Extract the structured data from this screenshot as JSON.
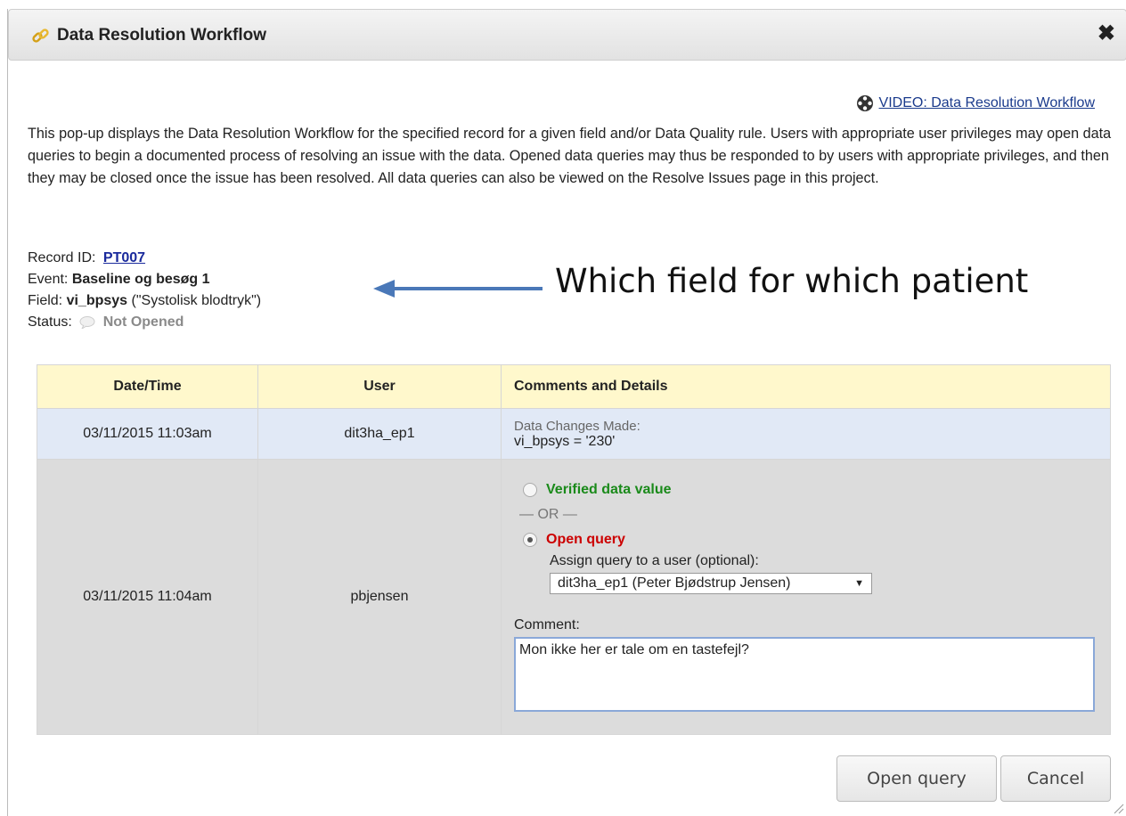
{
  "dialog": {
    "title": "Data Resolution Workflow",
    "close_symbol": "✖",
    "video_link": "VIDEO: Data Resolution Workflow",
    "intro": "This pop-up displays the Data Resolution Workflow for the specified record for a given field and/or Data Quality rule. Users with appropriate user privileges may open data queries to begin a documented process of resolving an issue with the data. Opened data queries may thus be responded to by users with appropriate privileges, and then they may be closed once the issue has been resolved. All data queries can also be viewed on the Resolve Issues page in this project."
  },
  "record": {
    "record_label": "Record ID:",
    "record_id": "PT007",
    "event_label": "Event:",
    "event": "Baseline og besøg 1",
    "field_label": "Field:",
    "field_name": "vi_bpsys",
    "field_desc": "(\"Systolisk blodtryk\")",
    "status_label": "Status:",
    "status": "Not Opened"
  },
  "annotation": {
    "text": "Which field for which patient",
    "arrow_color": "#4a78b8"
  },
  "table": {
    "headers": [
      "Date/Time",
      "User",
      "Comments and Details"
    ],
    "row1": {
      "datetime": "03/11/2015 11:03am",
      "user": "dit3ha_ep1",
      "changes_label": "Data Changes Made:",
      "changes_value": "vi_bpsys = '230'"
    },
    "row2": {
      "datetime": "03/11/2015 11:04am",
      "user": "pbjensen",
      "verified_label": "Verified data value",
      "or_text": "— OR —",
      "open_query_label": "Open query",
      "assign_label": "Assign query to a user (optional):",
      "assign_selected": "dit3ha_ep1 (Peter Bjødstrup Jensen)",
      "comment_label": "Comment:",
      "comment_value": "Mon ikke her er tale om en tastefejl?"
    }
  },
  "buttons": {
    "open_query": "Open query",
    "cancel": "Cancel"
  },
  "colors": {
    "header_bg": "#fff8cc",
    "row1_bg": "#e1e9f6",
    "row2_bg": "#dcdcdc",
    "verified": "#1a8a1a",
    "open_query": "#cc0000",
    "link": "#1a2a9c"
  }
}
